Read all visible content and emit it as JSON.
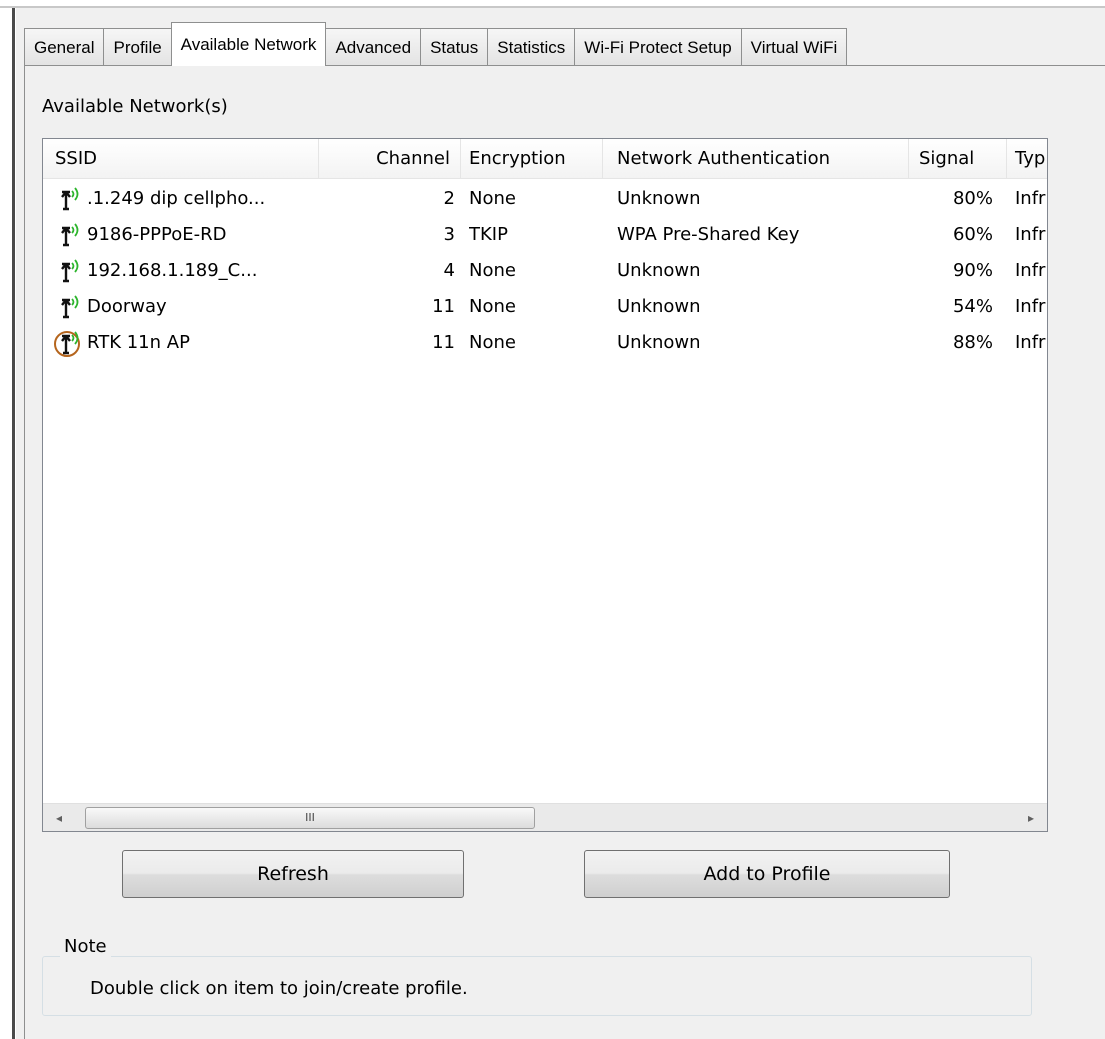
{
  "tabs": [
    {
      "label": "General",
      "active": false
    },
    {
      "label": "Profile",
      "active": false
    },
    {
      "label": "Available Network",
      "active": true
    },
    {
      "label": "Advanced",
      "active": false
    },
    {
      "label": "Status",
      "active": false
    },
    {
      "label": "Statistics",
      "active": false
    },
    {
      "label": "Wi-Fi Protect Setup",
      "active": false
    },
    {
      "label": "Virtual WiFi",
      "active": false
    }
  ],
  "section_label": "Available Network(s)",
  "table": {
    "columns": [
      "SSID",
      "Channel",
      "Encryption",
      "Network Authentication",
      "Signal",
      "Typ"
    ],
    "rows": [
      {
        "ssid": ".1.249 dip cellpho...",
        "channel": "2",
        "encryption": "None",
        "auth": "Unknown",
        "signal": "80%",
        "type": "Infr",
        "connected": false
      },
      {
        "ssid": "9186-PPPoE-RD",
        "channel": "3",
        "encryption": "TKIP",
        "auth": "WPA Pre-Shared Key",
        "signal": "60%",
        "type": "Infr",
        "connected": false
      },
      {
        "ssid": "192.168.1.189_C...",
        "channel": "4",
        "encryption": "None",
        "auth": "Unknown",
        "signal": "90%",
        "type": "Infr",
        "connected": false
      },
      {
        "ssid": "Doorway",
        "channel": "11",
        "encryption": "None",
        "auth": "Unknown",
        "signal": "54%",
        "type": "Infr",
        "connected": false
      },
      {
        "ssid": "RTK 11n AP",
        "channel": "11",
        "encryption": "None",
        "auth": "Unknown",
        "signal": "88%",
        "type": "Infr",
        "connected": true
      }
    ]
  },
  "scrollbar": {
    "left_arrow": "◂",
    "right_arrow": "▸",
    "grip": "III"
  },
  "buttons": {
    "refresh": "Refresh",
    "add_to_profile": "Add to Profile"
  },
  "note": {
    "legend": "Note",
    "text": "Double click on item to join/create profile."
  },
  "colors": {
    "signal_wave": "#2db52d",
    "connected_ring": "#b5651d",
    "window_bg": "#f0f0f0"
  }
}
